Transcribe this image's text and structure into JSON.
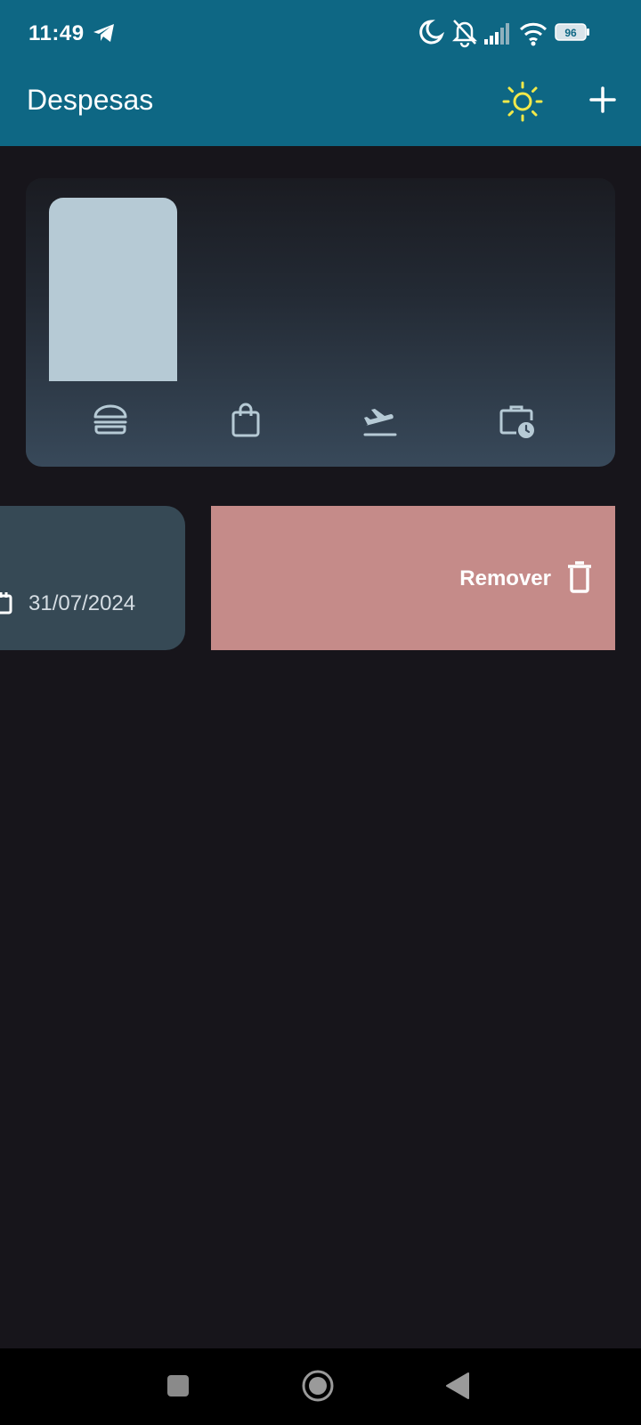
{
  "status_bar": {
    "time": "11:49",
    "battery": "96",
    "icons": [
      "telegram-icon",
      "moon-icon",
      "mute-icon",
      "signal-icon",
      "wifi-icon",
      "battery-icon"
    ]
  },
  "app_bar": {
    "title": "Despesas",
    "theme_icon": "sun-icon",
    "add_icon": "plus-icon"
  },
  "chart_data": {
    "type": "bar",
    "categories": [
      "food",
      "shopping",
      "travel",
      "work"
    ],
    "category_icons": [
      "burger-icon",
      "shopping-bag-icon",
      "flight-takeoff-icon",
      "work-history-icon"
    ],
    "values": [
      1,
      0,
      0,
      0
    ],
    "ylim": [
      0,
      1
    ],
    "bar_color": "#b6cad5",
    "title": "",
    "xlabel": "",
    "ylabel": ""
  },
  "expense": {
    "date": "31/07/2024",
    "date_icon": "calendar-icon"
  },
  "swipe_action": {
    "label": "Remover",
    "icon": "trash-icon",
    "color": "#c58b89"
  },
  "colors": {
    "app_bar": "#0e6784",
    "background": "#17151b",
    "card": "#364955",
    "accent_sun": "#f2e94a"
  },
  "nav_bar": {
    "icons": [
      "recents-icon",
      "home-icon",
      "back-icon"
    ]
  }
}
